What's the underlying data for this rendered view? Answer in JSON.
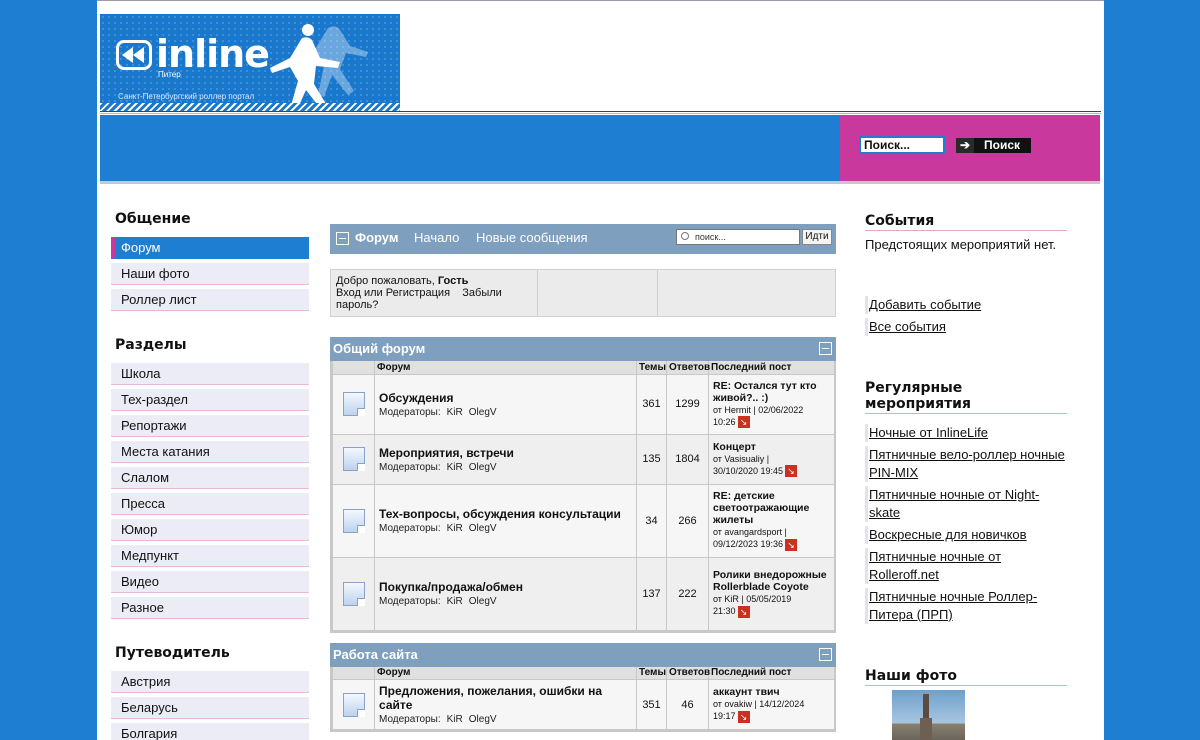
{
  "header": {
    "logo_brand": "inline",
    "logo_city": "Питер",
    "logo_tagline": "Санкт-Петербургский роллер портал",
    "search_value": "Поиск...",
    "search_button": "Поиск",
    "colors": {
      "blue": "#1e7fd2",
      "pink": "#c9399d"
    }
  },
  "left": {
    "sections": [
      {
        "title": "Общение",
        "items": [
          "Форум",
          "Наши фото",
          "Роллер лист"
        ],
        "active": 0
      },
      {
        "title": "Разделы",
        "items": [
          "Школа",
          "Тех-раздел",
          "Репортажи",
          "Места катания",
          "Слалом",
          "Пресса",
          "Юмор",
          "Медпункт",
          "Видео",
          "Разное"
        ]
      },
      {
        "title": "Путеводитель",
        "items": [
          "Австрия",
          "Беларусь",
          "Болгария"
        ]
      }
    ]
  },
  "forum": {
    "nav": {
      "forum": "Форум",
      "home": "Начало",
      "new": "Новые сообщения"
    },
    "search_placeholder": "поиск...",
    "search_button": "Идти",
    "welcome": {
      "greeting": "Добро пожаловать, ",
      "guest": "Гость",
      "login": "Вход",
      "or": " или ",
      "register": "Регистрация",
      "forgot": "Забыли пароль?"
    },
    "columns": {
      "forum": "Форум",
      "topics": "Темы",
      "replies": "Ответов",
      "last": "Последний пост"
    },
    "mod_label": "Модераторы:",
    "mods": [
      "KiR",
      "OlegV"
    ],
    "categories": [
      {
        "title": "Общий форум",
        "forums": [
          {
            "title": "Обсуждения",
            "topics": "361",
            "replies": "1299",
            "last_title": "RE: Остался тут кто живой?.. :)",
            "last_by": "от Hermit | 02/06/2022",
            "last_time": "10:26"
          },
          {
            "title": "Мероприятия, встречи",
            "topics": "135",
            "replies": "1804",
            "last_title": "Концерт",
            "last_by": "от Vasisualiy |",
            "last_time": "30/10/2020 19:45"
          },
          {
            "title": "Тех-вопросы, обсуждения консультации",
            "topics": "34",
            "replies": "266",
            "last_title": "RE: детские светоотражающие жилеты",
            "last_by": "от avangardsport |",
            "last_time": "09/12/2023 19:36"
          },
          {
            "title": "Покупка/продажа/обмен",
            "topics": "137",
            "replies": "222",
            "last_title": "Ролики внедорожные Rollerblade Coyote",
            "last_by": "от KiR | 05/05/2019",
            "last_time": "21:30"
          }
        ]
      },
      {
        "title": "Работа сайта",
        "forums": [
          {
            "title": "Предложения, пожелания, ошибки на сайте",
            "topics": "351",
            "replies": "46",
            "last_title": "аккаунт твич",
            "last_by": "от ovakiw | 14/12/2024",
            "last_time": "19:17"
          }
        ]
      }
    ]
  },
  "right": {
    "events_title": "События",
    "events_text": "Предстоящих мероприятий нет.",
    "add_event": "Добавить событие",
    "all_events": "Все события",
    "regular_title": "Регулярные мероприятия",
    "regular": [
      "Ночные от InlineLife",
      "Пятничные вело-роллер ночные PIN-MIX",
      "Пятничные ночные от Night-skate",
      "Воскресные для новичков",
      "Пятничные ночные от Rolleroff.net",
      "Пятничные ночные Роллер-Питера (ПРП)"
    ],
    "photos_title": "Наши фото"
  }
}
